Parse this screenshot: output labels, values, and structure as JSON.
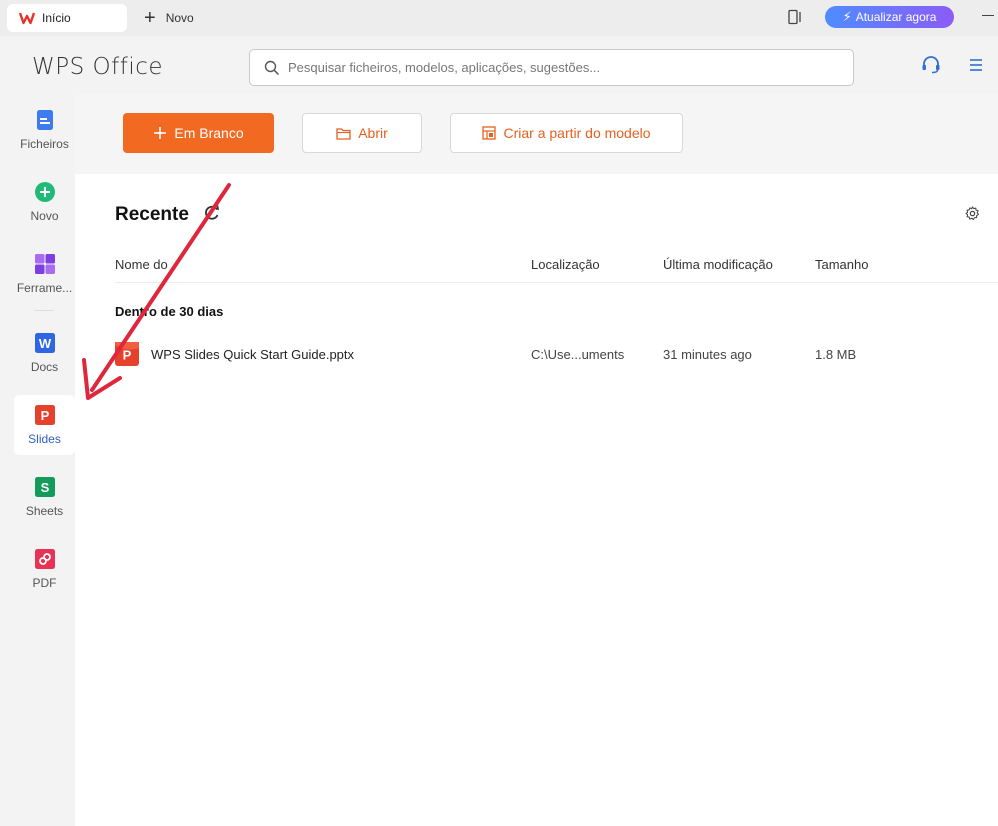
{
  "tabs": {
    "active_label": "Início",
    "new_label": "Novo"
  },
  "upgrade": {
    "label": "Atualizar agora"
  },
  "header": {
    "brand": "WPS Office",
    "search_placeholder": "Pesquisar ficheiros, modelos, aplicações, sugestões..."
  },
  "sidebar": {
    "items": [
      {
        "label": "Ficheiros",
        "icon": "files-icon"
      },
      {
        "label": "Novo",
        "icon": "new-plus-icon"
      },
      {
        "label": "Ferrame...",
        "icon": "tools-icon"
      },
      {
        "label": "Docs",
        "icon": "docs-w-icon"
      },
      {
        "label": "Slides",
        "icon": "slides-p-icon"
      },
      {
        "label": "Sheets",
        "icon": "sheets-s-icon"
      },
      {
        "label": "PDF",
        "icon": "pdf-icon"
      }
    ],
    "active": "Slides"
  },
  "actions": {
    "blank_label": "Em Branco",
    "open_label": "Abrir",
    "template_label": "Criar a partir do modelo"
  },
  "recent": {
    "title": "Recente",
    "columns": {
      "name": "Nome do",
      "location": "Localização",
      "modified": "Última modificação",
      "size": "Tamanho"
    },
    "group_label": "Dentro de 30 dias",
    "files": [
      {
        "name": "WPS Slides Quick Start Guide.pptx",
        "location": "C:\\Use...uments",
        "modified": "31 minutes ago",
        "size": "1.8 MB"
      }
    ]
  },
  "colors": {
    "accent_orange": "#f26a22",
    "active_blue": "#2f5fc9",
    "annotation_red": "#e0263c"
  }
}
